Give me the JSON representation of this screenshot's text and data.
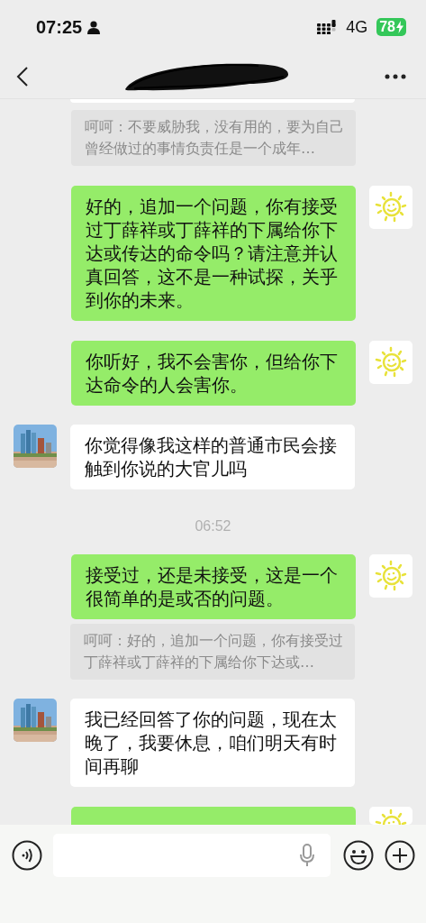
{
  "status_bar": {
    "time": "07:25",
    "network": "4G",
    "battery": "78",
    "charging": true
  },
  "messages": [
    {
      "kind": "cut_received"
    },
    {
      "kind": "quote",
      "text": "呵呵：不要威胁我，没有用的，要为自己曾经做过的事情负责任是一个成年…"
    },
    {
      "kind": "sent",
      "text": "好的，追加一个问题，你有接受过丁薛祥或丁薛祥的下属给你下达或传达的命令吗？请注意并认真回答，这不是一种试探，关乎到你的未来。"
    },
    {
      "kind": "sent",
      "text": "你听好，我不会害你，但给你下达命令的人会害你。"
    },
    {
      "kind": "received",
      "text": "你觉得像我这样的普通市民会接触到你说的大官儿吗"
    },
    {
      "kind": "time",
      "text": "06:52"
    },
    {
      "kind": "sent",
      "text": "接受过，还是未接受，这是一个很简单的是或否的问题。"
    },
    {
      "kind": "quote",
      "text": "呵呵：好的，追加一个问题，你有接受过丁薛祥或丁薛祥的下属给你下达或…"
    },
    {
      "kind": "received",
      "text": "我已经回答了你的问题，现在太晚了，我要休息，咱们明天有时间再聊"
    },
    {
      "kind": "cut_sent"
    }
  ]
}
